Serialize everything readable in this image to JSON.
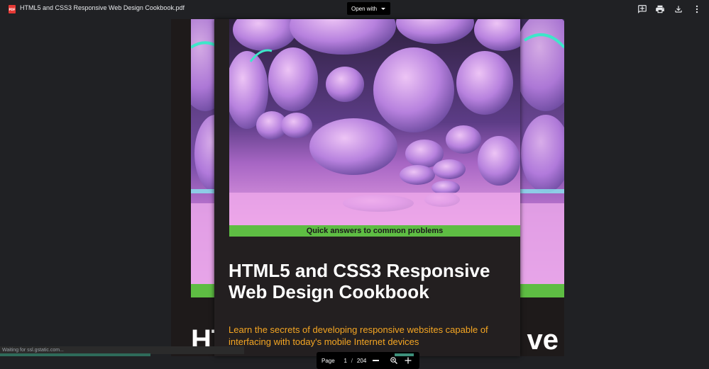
{
  "topbar": {
    "file_icon_text": "PDF",
    "file_title": "HTML5 and CSS3 Responsive Web Design Cookbook.pdf",
    "open_with_label": "Open with"
  },
  "icons": {
    "add_comment": "add-comment-icon",
    "print": "print-icon",
    "download": "download-icon",
    "more": "more-vert-icon"
  },
  "back_page": {
    "title_left": "HT",
    "title_right": "ve"
  },
  "front_page": {
    "banner": "Quick answers to common problems",
    "title": "HTML5 and CSS3 Responsive Web Design Cookbook",
    "subtitle": "Learn the secrets of developing responsive websites capable of interfacing with today's mobile Internet devices"
  },
  "page_control": {
    "label": "Page",
    "current": "1",
    "separator": "/",
    "total": "204"
  },
  "status": {
    "text": "Waiting for ssl.gstatic.com..."
  },
  "colors": {
    "background": "#202124",
    "banner_green": "#5ebd43",
    "subtitle_orange": "#f5a623",
    "page_dark": "#231f20"
  }
}
